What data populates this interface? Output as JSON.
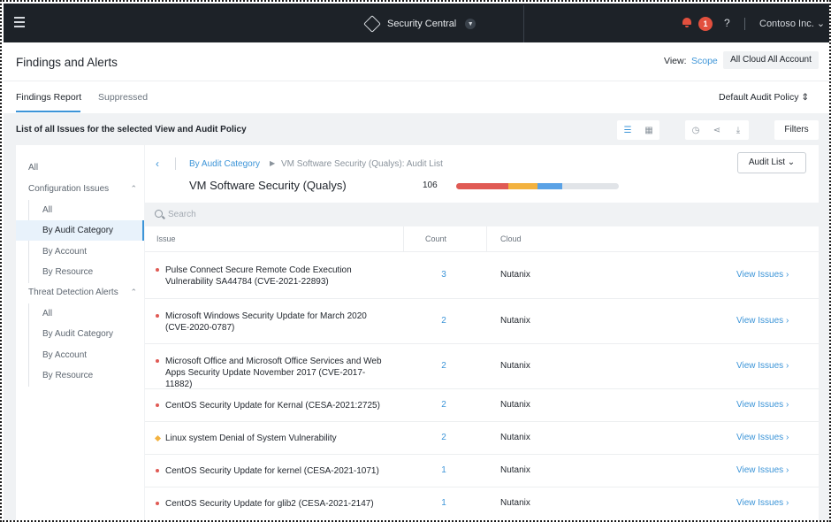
{
  "topbar": {
    "app_name": "Security Central",
    "notification_count": "1",
    "help": "?",
    "account": "Contoso Inc. ⌄"
  },
  "header": {
    "title": "Findings and Alerts",
    "view_label": "View:",
    "view_scope": "Scope",
    "view_value": "All Cloud All Account"
  },
  "tabs": [
    {
      "label": "Findings Report",
      "active": true
    },
    {
      "label": "Suppressed",
      "active": false
    }
  ],
  "policy_select": "Default Audit Policy ⇕",
  "list_caption": "List of all Issues for the selected View and Audit Policy",
  "filters_label": "Filters",
  "sidebar": {
    "all": "All",
    "configuration_issues": "Configuration Issues",
    "config_items": [
      "All",
      "By Audit Category",
      "By Account",
      "By Resource"
    ],
    "threat_detection_alerts": "Threat Detection Alerts",
    "threat_items": [
      "All",
      "By Audit Category",
      "By Account",
      "By Resource"
    ]
  },
  "main": {
    "breadcrumb_link": "By Audit Category",
    "breadcrumb_current": "VM Software Security (Qualys): Audit List",
    "audit_list_button": "Audit List ⌄",
    "section_title": "VM Software Security (Qualys)",
    "total_count": "106",
    "severity_bar": [
      {
        "level": "critical",
        "fraction": 0.32,
        "color": "#e05a54"
      },
      {
        "level": "warning",
        "fraction": 0.18,
        "color": "#f3b23f"
      },
      {
        "level": "info",
        "fraction": 0.15,
        "color": "#5aa2e6"
      }
    ],
    "search_placeholder": "Search",
    "columns": [
      "Issue",
      "Count",
      "Cloud"
    ],
    "rows": [
      {
        "issue": "Pulse Connect Secure Remote Code Execution Vulnerability SA44784 (CVE-2021-22893)",
        "count": "3",
        "cloud": "Nutanix",
        "severity": "critical",
        "action": "View Issues ›"
      },
      {
        "issue": "Microsoft Windows Security Update for March 2020 (CVE-2020-0787)",
        "count": "2",
        "cloud": "Nutanix",
        "severity": "critical",
        "action": "View Issues ›"
      },
      {
        "issue": "Microsoft Office and Microsoft Office Services and Web Apps Security Update November 2017 (CVE-2017-11882)",
        "count": "2",
        "cloud": "Nutanix",
        "severity": "critical",
        "action": "View Issues ›"
      },
      {
        "issue": "CentOS Security Update for Kernal (CESA-2021:2725)",
        "count": "2",
        "cloud": "Nutanix",
        "severity": "critical",
        "action": "View Issues ›"
      },
      {
        "issue": "Linux system Denial of System Vulnerability",
        "count": "2",
        "cloud": "Nutanix",
        "severity": "warning",
        "action": "View Issues ›"
      },
      {
        "issue": "CentOS Security Update for kernel (CESA-2021-1071)",
        "count": "1",
        "cloud": "Nutanix",
        "severity": "critical",
        "action": "View Issues ›"
      },
      {
        "issue": "CentOS Security Update for glib2 (CESA-2021-2147)",
        "count": "1",
        "cloud": "Nutanix",
        "severity": "critical",
        "action": "View Issues ›"
      }
    ]
  },
  "colors": {
    "accent": "#3d95d8",
    "critical": "#e05a54",
    "warning": "#f3b23f",
    "topbar": "#1d2228"
  }
}
